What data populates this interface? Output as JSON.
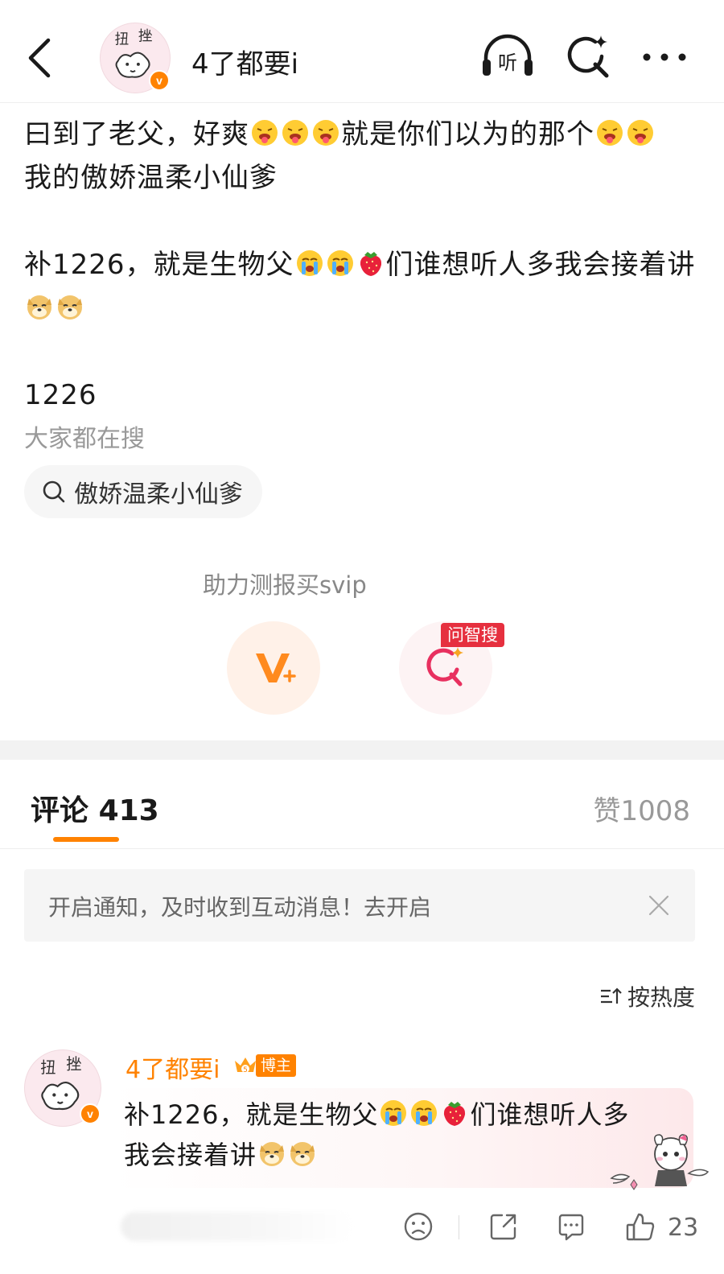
{
  "header": {
    "user_name": "4了都要i",
    "avatar_text": "扭 挫",
    "listen_label": "听"
  },
  "post": {
    "line1_a": "曰到了老父，好爽",
    "line1_b": "就是你们以为的那个",
    "line2": "我的傲娇温柔小仙爹",
    "para2_a": "补1226，就是生物父",
    "para2_b": "们谁想听人多我会接着讲",
    "para3": "1226"
  },
  "search": {
    "title": "大家都在搜",
    "chip": "傲娇温柔小仙爹"
  },
  "promo": {
    "vip_label": "助力测报买svip",
    "ask_badge": "问智搜"
  },
  "comments_tab": {
    "label": "评论",
    "count": "413",
    "likes_label": "赞",
    "likes_count": "1008"
  },
  "notice": {
    "text": "开启通知，及时收到互动消息！去开启"
  },
  "sort": {
    "label": "按热度"
  },
  "comment": {
    "user_name": "4了都要i",
    "tag": "博主",
    "text_a": "补1226，就是生物父",
    "text_b": "们谁想听人多",
    "text_c": "我会接着讲",
    "like_count": "23"
  },
  "icons": {
    "back": "chevron-left-icon",
    "listen": "headphones-icon",
    "ai_search": "sparkle-search-icon",
    "more": "more-dots-icon",
    "emoji_tongue": "tongue-face-emoji",
    "emoji_cry": "crying-face-emoji",
    "emoji_strawberry": "strawberry-emoji",
    "emoji_doge": "doge-emoji"
  },
  "colors": {
    "accent": "#ff8200",
    "badge_red": "#e6303f",
    "muted": "#999999"
  }
}
